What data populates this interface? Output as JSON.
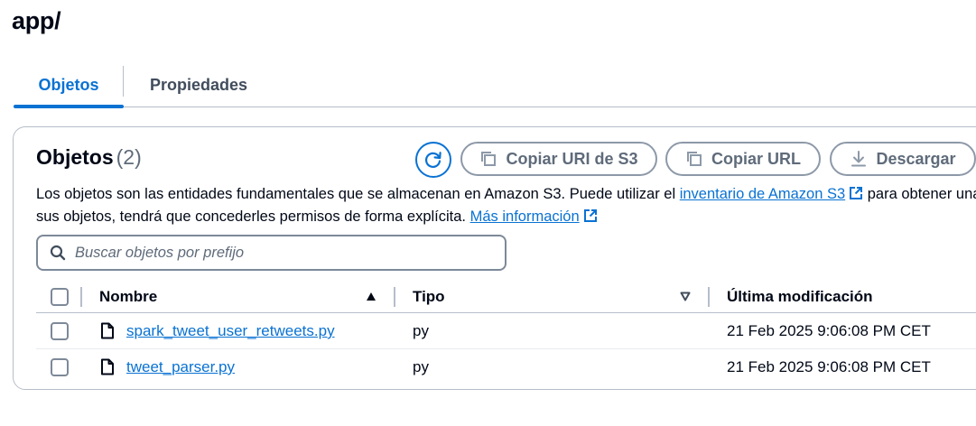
{
  "page": {
    "title": "app/"
  },
  "tabs": [
    {
      "label": "Objetos",
      "active": true
    },
    {
      "label": "Propiedades",
      "active": false
    }
  ],
  "panel": {
    "title": "Objetos",
    "count": "(2)",
    "buttons": {
      "refresh_icon": "refresh-icon",
      "copy_s3_uri": "Copiar URI de S3",
      "copy_url": "Copiar URL",
      "download": "Descargar"
    },
    "description": {
      "text1": "Los objetos son las entidades fundamentales que se almacenan en Amazon S3. Puede utilizar el ",
      "link1": "inventario de Amazon S3",
      "text2": " para obtener una lista de todos los objetos del bucket. Para que otras personas obtengan permisos de acceso a",
      "line2_text": "sus objetos, tendrá que concederles permisos de forma explícita. ",
      "link2": "Más información"
    },
    "search": {
      "placeholder": "Buscar objetos por prefijo",
      "value": ""
    },
    "table": {
      "columns": [
        "Nombre",
        "Tipo",
        "Última modificación"
      ],
      "rows": [
        {
          "name": "spark_tweet_user_retweets.py",
          "type": "py",
          "modified": "21 Feb 2025 9:06:08 PM CET"
        },
        {
          "name": "tweet_parser.py",
          "type": "py",
          "modified": "21 Feb 2025 9:06:08 PM CET"
        }
      ]
    }
  },
  "colors": {
    "accent": "#0972d3",
    "text": "#000716",
    "muted": "#5f6b7a",
    "border": "#b6bec9"
  }
}
